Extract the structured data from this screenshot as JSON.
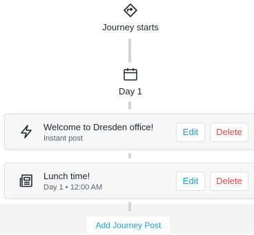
{
  "journey": {
    "start_label": "Journey starts",
    "start_icon": "diamond-route-icon",
    "day_label": "Day 1",
    "day_icon": "calendar-icon"
  },
  "posts": [
    {
      "title": "Welcome to Dresden office!",
      "subtitle": "Instant post",
      "icon": "lightning-icon",
      "edit_label": "Edit",
      "delete_label": "Delete"
    },
    {
      "title": "Lunch time!",
      "subtitle": "Day 1 • 12:00 AM",
      "icon": "newspaper-icon",
      "edit_label": "Edit",
      "delete_label": "Delete"
    }
  ],
  "add_post_label": "Add Journey Post",
  "colors": {
    "accent": "#1aa0d6",
    "danger": "#e5484d",
    "connector": "#d4d4d8"
  }
}
